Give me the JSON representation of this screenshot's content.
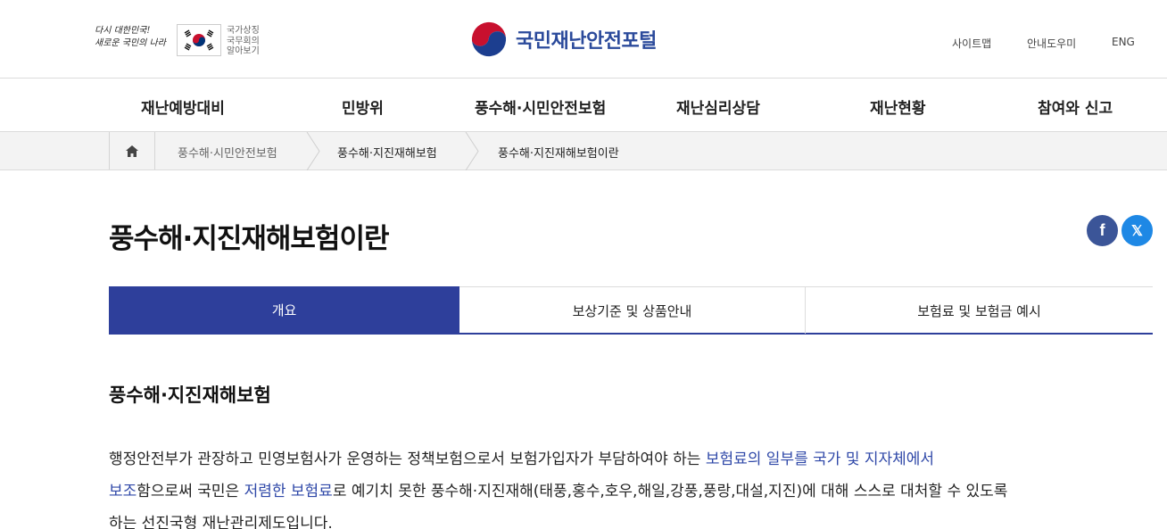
{
  "header": {
    "slogan_line1": "다시 대한민국!",
    "slogan_line2": "새로운 국민의 나라",
    "symbol_line1": "국가상징",
    "symbol_line2": "국무회의",
    "symbol_line3": "알아보기",
    "site_title": "국민재난안전포털",
    "util": {
      "sitemap": "사이트맵",
      "help": "안내도우미",
      "eng": "ENG"
    }
  },
  "gnb": [
    "재난예방대비",
    "민방위",
    "풍수해·시민안전보험",
    "재난심리상담",
    "재난현황",
    "참여와 신고"
  ],
  "breadcrumb": [
    "풍수해·시민안전보험",
    "풍수해·지진재해보험",
    "풍수해·지진재해보험이란"
  ],
  "page_title": "풍수해·지진재해보험이란",
  "share": {
    "facebook": "f",
    "x": "𝕏"
  },
  "tabs": [
    "개요",
    "보상기준 및 상품안내",
    "보험료 및 보험금 예시"
  ],
  "content": {
    "section_title": "풍수해·지진재해보험",
    "line1_a": "행정안전부가 관장하고 민영보험사가 운영하는 정책보험으로서 보험가입자가 부담하여야 하는 ",
    "line1_hl": "보험료의 일부를 국가 및 지자체에서",
    "line2_hl1": "보조",
    "line2_a": "함으로써 국민은 ",
    "line2_hl2": "저렴한 보험료",
    "line2_b": "로 예기치 못한 풍수해·지진재해(태풍,홍수,호우,해일,강풍,풍랑,대설,지진)에 대해 스스로 대처할 수 있도록",
    "line3": "하는 선진국형 재난관리제도입니다."
  },
  "colors": {
    "brand_blue": "#2e3f9b",
    "link_blue": "#2f48a8",
    "facebook": "#3b5598",
    "x": "#1e88e5"
  },
  "icons": [
    "home-icon",
    "facebook-icon",
    "x-icon",
    "taegeuk-flag-icon",
    "government-logo-icon",
    "chevron-right-icon"
  ]
}
